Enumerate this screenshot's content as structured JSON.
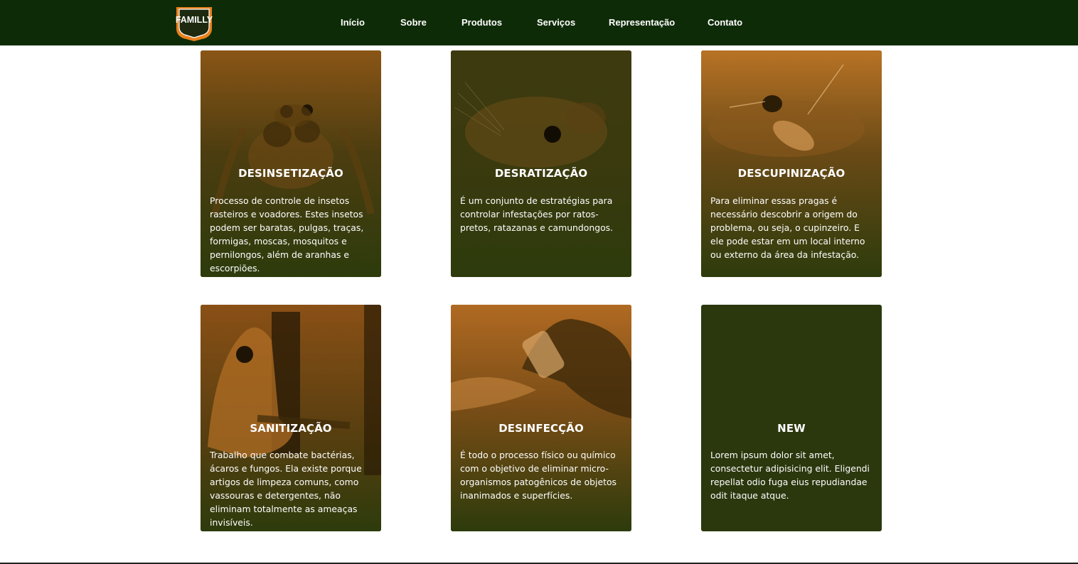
{
  "brand": {
    "logo_text": "FAMILLY"
  },
  "colors": {
    "nav_bg": "#0e2b07",
    "card_bg": "#2d3b0c",
    "accent": "#e9821c"
  },
  "nav": {
    "items": [
      {
        "label": "Início"
      },
      {
        "label": "Sobre"
      },
      {
        "label": "Produtos"
      },
      {
        "label": "Serviços"
      },
      {
        "label": "Representação"
      },
      {
        "label": "Contato"
      }
    ]
  },
  "services": [
    {
      "title": "DESINSETIZAÇÃO",
      "text": "Processo de controle de insetos rasteiros e voadores. Estes insetos podem ser baratas, pulgas, traças, formigas, moscas, mosquitos e pernilongos, além de aranhas e escorpiões.",
      "image": "spider-photo"
    },
    {
      "title": "DESRATIZAÇÃO",
      "text": "É um conjunto de estratégias para controlar infestações por ratos-pretos, ratazanas e camundongos.",
      "image": "rat-photo"
    },
    {
      "title": "DESCUPINIZAÇÃO",
      "text": "Para eliminar essas pragas é necessário descobrir a origem do problema, ou seja, o cupinzeiro. E ele pode estar em um local interno ou externo da área da infestação.",
      "image": "termite-photo"
    },
    {
      "title": "SANITIZAÇÃO",
      "text": "Trabalho que combate bactérias, ácaros e fungos. Ela existe porque artigos de limpeza comuns, como vassouras e detergentes, não eliminam totalmente as ameaças invisíveis.",
      "image": "hazmat-photo"
    },
    {
      "title": "DESINFECÇÃO",
      "text": "É todo o processo físico ou químico com o objetivo de eliminar micro-organismos patogênicos de objetos inanimados e superfícies.",
      "image": "sprayer-photo"
    },
    {
      "title": "NEW",
      "text": "Lorem ipsum dolor sit amet, consectetur adipisicing elit. Eligendi repellat odio fuga eius repudiandae odit itaque atque.",
      "image": ""
    }
  ]
}
